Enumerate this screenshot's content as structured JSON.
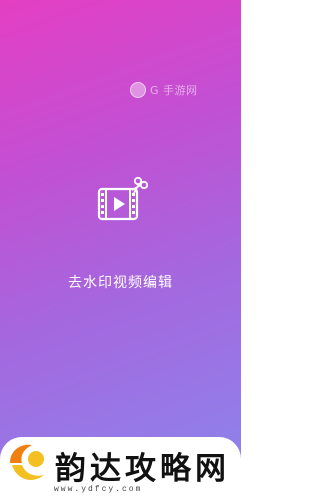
{
  "watermark": {
    "text": "G 手游网",
    "logo_icon": "watermark-logo"
  },
  "splash": {
    "icon": "video-scissors-icon",
    "title": "去水印视频编辑"
  },
  "footer": {
    "site_name": "韵达攻略网",
    "url": "www.ydfcy.com",
    "logo_icon": "site-logo"
  },
  "colors": {
    "gradient_top": "#e43fc3",
    "gradient_bottom": "#8a87ec",
    "logo_yellow": "#f4c021",
    "logo_orange": "#f07f10"
  }
}
